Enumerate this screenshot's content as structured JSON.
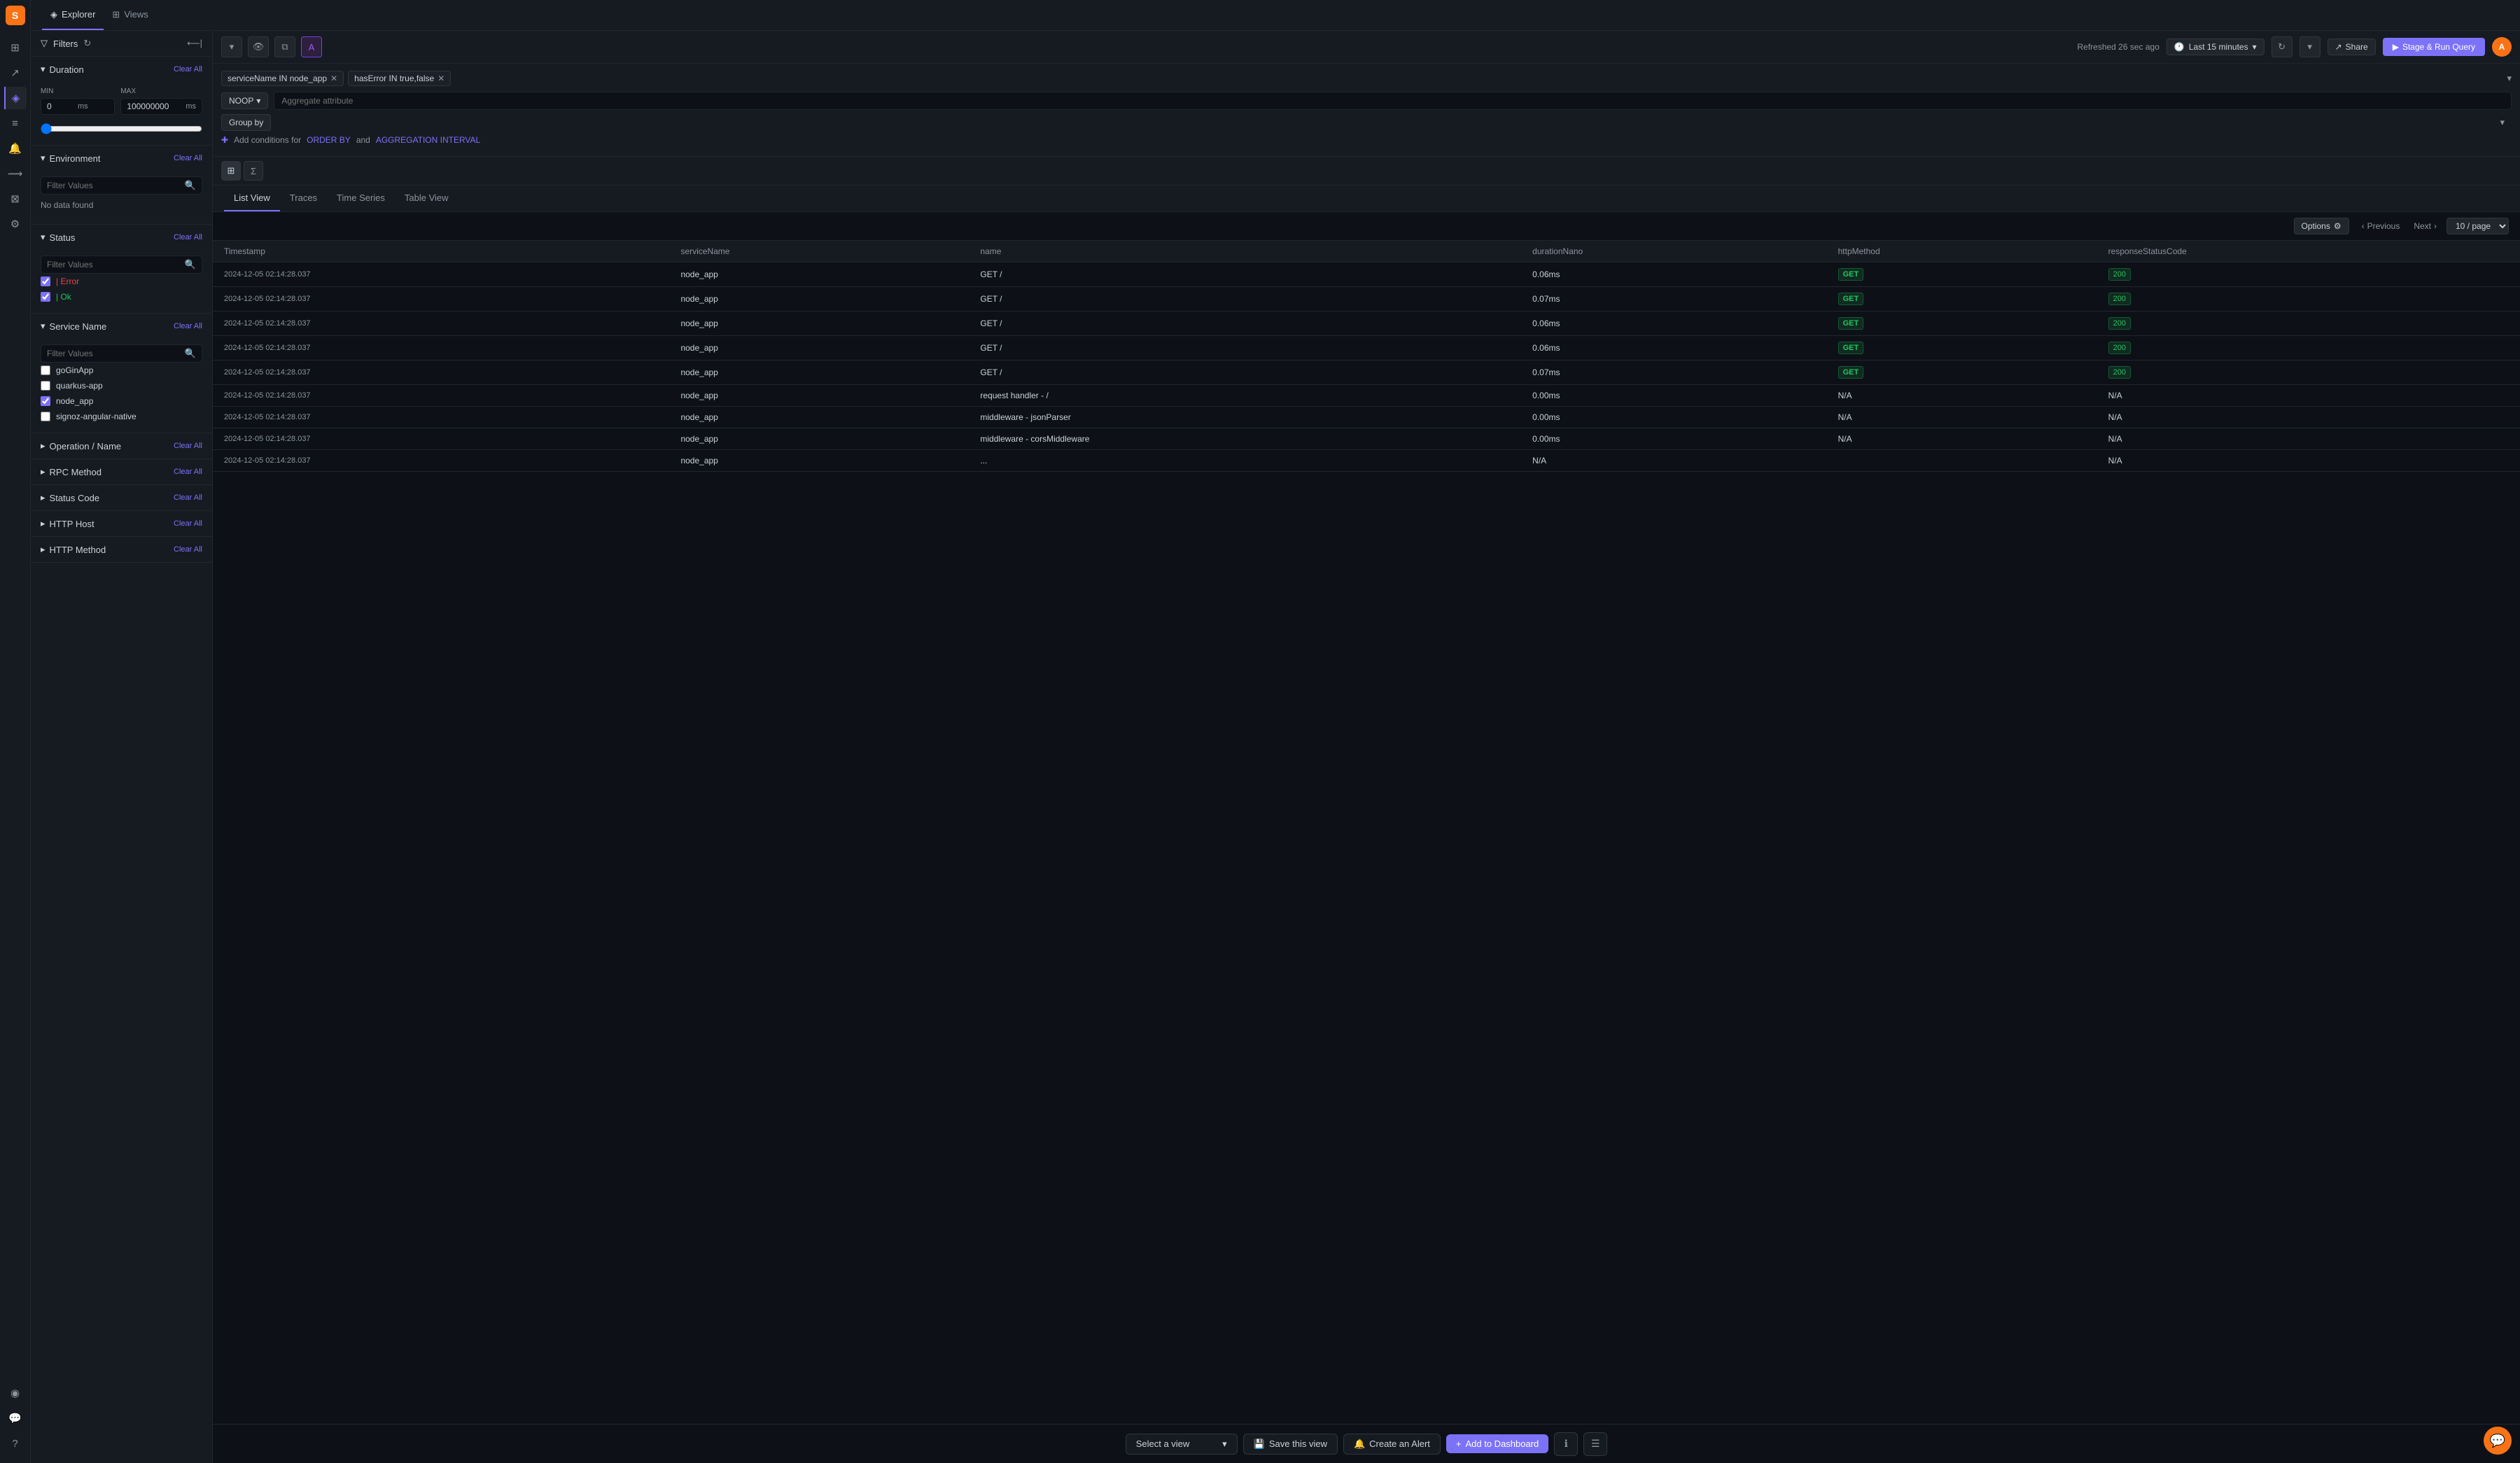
{
  "app": {
    "logo": "S",
    "tabs": [
      {
        "id": "explorer",
        "label": "Explorer",
        "active": true
      },
      {
        "id": "views",
        "label": "Views",
        "active": false
      }
    ]
  },
  "sidebar": {
    "icons": [
      {
        "id": "dashboard",
        "symbol": "⊞",
        "active": false
      },
      {
        "id": "chart",
        "symbol": "↗",
        "active": false
      },
      {
        "id": "trace",
        "symbol": "◈",
        "active": true
      },
      {
        "id": "log",
        "symbol": "≡",
        "active": false
      },
      {
        "id": "alert",
        "symbol": "🔔",
        "active": false
      },
      {
        "id": "pipeline",
        "symbol": "⟿",
        "active": false
      },
      {
        "id": "query",
        "symbol": "⊠",
        "active": false
      },
      {
        "id": "settings",
        "symbol": "⚙",
        "active": false
      }
    ],
    "bottom_icons": [
      {
        "id": "community",
        "symbol": "◉"
      },
      {
        "id": "chat",
        "symbol": "💬"
      },
      {
        "id": "help",
        "symbol": "?"
      }
    ]
  },
  "toolbar": {
    "refresh_text": "Refreshed 26 sec ago",
    "time_range": "Last 15 minutes",
    "share_label": "Share",
    "stage_run_label": "Stage & Run Query",
    "filter_label": "Filters"
  },
  "query_builder": {
    "filter_tags": [
      {
        "id": "service",
        "text": "serviceName IN node_app"
      },
      {
        "id": "error",
        "text": "hasError IN true,false"
      }
    ],
    "operation": "NOOP",
    "aggregate_placeholder": "Aggregate attribute",
    "group_by_label": "Group by",
    "add_conditions_text": "Add conditions for",
    "order_by_link": "ORDER BY",
    "and_text": "and",
    "aggregation_interval_link": "AGGREGATION INTERVAL"
  },
  "results": {
    "tabs": [
      {
        "id": "list",
        "label": "List View",
        "active": true
      },
      {
        "id": "traces",
        "label": "Traces",
        "active": false
      },
      {
        "id": "timeseries",
        "label": "Time Series",
        "active": false
      },
      {
        "id": "table",
        "label": "Table View",
        "active": false
      }
    ],
    "options_label": "Options",
    "prev_label": "Previous",
    "next_label": "Next",
    "per_page": "10 / page",
    "columns": [
      "Timestamp",
      "serviceName",
      "name",
      "durationNano",
      "httpMethod",
      "responseStatusCode"
    ],
    "rows": [
      {
        "timestamp": "2024-12-05 02:14:28.037",
        "service": "node_app",
        "name": "GET /",
        "duration": "0.06ms",
        "method": "GET",
        "status": "200"
      },
      {
        "timestamp": "2024-12-05 02:14:28.037",
        "service": "node_app",
        "name": "GET /",
        "duration": "0.07ms",
        "method": "GET",
        "status": "200"
      },
      {
        "timestamp": "2024-12-05 02:14:28.037",
        "service": "node_app",
        "name": "GET /",
        "duration": "0.06ms",
        "method": "GET",
        "status": "200"
      },
      {
        "timestamp": "2024-12-05 02:14:28.037",
        "service": "node_app",
        "name": "GET /",
        "duration": "0.06ms",
        "method": "GET",
        "status": "200"
      },
      {
        "timestamp": "2024-12-05 02:14:28.037",
        "service": "node_app",
        "name": "GET /",
        "duration": "0.07ms",
        "method": "GET",
        "status": "200"
      },
      {
        "timestamp": "2024-12-05 02:14:28.037",
        "service": "node_app",
        "name": "request handler - /",
        "duration": "0.00ms",
        "method": "N/A",
        "status": "N/A"
      },
      {
        "timestamp": "2024-12-05 02:14:28.037",
        "service": "node_app",
        "name": "middleware - jsonParser",
        "duration": "0.00ms",
        "method": "N/A",
        "status": "N/A"
      },
      {
        "timestamp": "2024-12-05 02:14:28.037",
        "service": "node_app",
        "name": "middleware - corsMiddleware",
        "duration": "0.00ms",
        "method": "N/A",
        "status": "N/A"
      },
      {
        "timestamp": "2024-12-05 02:14:28.037",
        "service": "node_app",
        "name": "...",
        "duration": "N/A",
        "method": "",
        "status": "N/A"
      }
    ]
  },
  "filters": {
    "header": "Filters",
    "sections": [
      {
        "id": "duration",
        "title": "Duration",
        "expanded": true,
        "min_label": "MIN",
        "min_value": "0",
        "max_label": "MAX",
        "max_value": "100000000",
        "unit": "ms",
        "clear_label": "Clear All"
      },
      {
        "id": "environment",
        "title": "Environment",
        "expanded": true,
        "placeholder": "Filter Values",
        "no_data": "No data found",
        "clear_label": "Clear All"
      },
      {
        "id": "status",
        "title": "Status",
        "expanded": true,
        "placeholder": "Filter Values",
        "clear_label": "Clear All",
        "items": [
          {
            "label": "| Error",
            "checked": true
          },
          {
            "label": "| Ok",
            "checked": true
          }
        ]
      },
      {
        "id": "service-name",
        "title": "Service Name",
        "expanded": true,
        "placeholder": "Filter Values",
        "clear_label": "Clear All",
        "items": [
          {
            "label": "goGinApp",
            "checked": false
          },
          {
            "label": "quarkus-app",
            "checked": false
          },
          {
            "label": "node_app",
            "checked": true
          },
          {
            "label": "signoz-angular-native",
            "checked": false
          }
        ]
      },
      {
        "id": "operation-name",
        "title": "Operation / Name",
        "expanded": false,
        "clear_label": "Clear All"
      },
      {
        "id": "rpc-method",
        "title": "RPC Method",
        "expanded": false,
        "clear_label": "Clear All"
      },
      {
        "id": "status-code",
        "title": "Status Code",
        "expanded": false,
        "clear_label": "Clear All"
      },
      {
        "id": "http-host",
        "title": "HTTP Host",
        "expanded": false,
        "clear_label": "Clear All"
      },
      {
        "id": "http-method",
        "title": "HTTP Method",
        "expanded": false,
        "clear_label": "Clear All"
      }
    ]
  },
  "bottom_bar": {
    "select_view_placeholder": "Select a view",
    "save_view_label": "Save this view",
    "create_alert_label": "Create an Alert",
    "add_dashboard_label": "Add to Dashboard"
  }
}
